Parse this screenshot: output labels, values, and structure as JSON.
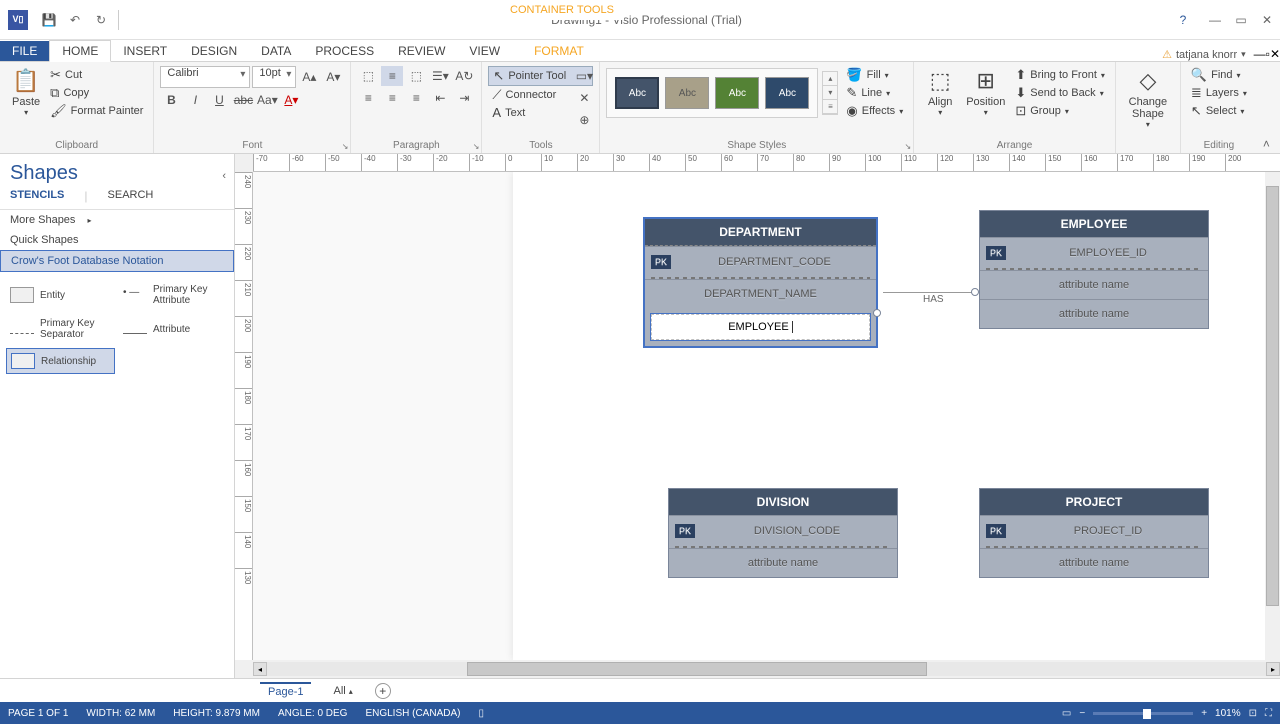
{
  "titlebar": {
    "visio_logo": "V▯",
    "title": "Drawing1 - Visio Professional (Trial)",
    "container_tools": "CONTAINER TOOLS"
  },
  "ribbon_tabs": {
    "file": "FILE",
    "home": "HOME",
    "insert": "INSERT",
    "design": "DESIGN",
    "data": "DATA",
    "process": "PROCESS",
    "review": "REVIEW",
    "view": "VIEW",
    "format": "FORMAT",
    "user": "tatjana knorr"
  },
  "ribbon": {
    "clipboard": {
      "paste": "Paste",
      "cut": "Cut",
      "copy": "Copy",
      "format_painter": "Format Painter",
      "label": "Clipboard"
    },
    "font": {
      "family": "Calibri",
      "size": "10pt",
      "label": "Font"
    },
    "paragraph": {
      "label": "Paragraph"
    },
    "tools": {
      "pointer": "Pointer Tool",
      "connector": "Connector",
      "text": "Text",
      "label": "Tools"
    },
    "shape_styles": {
      "abc": "Abc",
      "fill": "Fill",
      "line": "Line",
      "effects": "Effects",
      "label": "Shape Styles"
    },
    "arrange": {
      "align": "Align",
      "position": "Position",
      "bring_front": "Bring to Front",
      "send_back": "Send to Back",
      "group": "Group",
      "label": "Arrange"
    },
    "change_shape": "Change Shape",
    "editing": {
      "find": "Find",
      "layers": "Layers",
      "select": "Select",
      "label": "Editing"
    }
  },
  "shapes_panel": {
    "title": "Shapes",
    "tab_stencils": "STENCILS",
    "tab_search": "SEARCH",
    "more_shapes": "More Shapes",
    "quick_shapes": "Quick Shapes",
    "crows_foot": "Crow's Foot Database Notation",
    "entity": "Entity",
    "pk_attribute": "Primary Key Attribute",
    "pk_separator": "Primary Key Separator",
    "attribute": "Attribute",
    "relationship": "Relationship"
  },
  "canvas": {
    "ruler_h": [
      "-70",
      "-60",
      "-50",
      "-40",
      "-30",
      "-20",
      "-10",
      "0",
      "10",
      "20",
      "30",
      "40",
      "50",
      "60",
      "70",
      "80",
      "90",
      "100",
      "110",
      "120",
      "130",
      "140",
      "150",
      "160",
      "170",
      "180",
      "190",
      "200"
    ],
    "ruler_v": [
      "240",
      "230",
      "220",
      "210",
      "200",
      "190",
      "180",
      "170",
      "160",
      "150",
      "140",
      "130"
    ],
    "dept": {
      "title": "DEPARTMENT",
      "pk": "PK",
      "code": "DEPARTMENT_CODE",
      "name": "DEPARTMENT_NAME",
      "editing": "EMPLOYEE"
    },
    "emp": {
      "title": "EMPLOYEE",
      "pk": "PK",
      "id": "EMPLOYEE_ID",
      "a1": "attribute name",
      "a2": "attribute name"
    },
    "div": {
      "title": "DIVISION",
      "pk": "PK",
      "code": "DIVISION_CODE",
      "a1": "attribute name"
    },
    "proj": {
      "title": "PROJECT",
      "pk": "PK",
      "id": "PROJECT_ID",
      "a1": "attribute name"
    },
    "rel_has": "HAS"
  },
  "page_tabs": {
    "page1": "Page-1",
    "all": "All"
  },
  "statusbar": {
    "page": "PAGE 1 OF 1",
    "width": "WIDTH: 62 MM",
    "height": "HEIGHT: 9.879 MM",
    "angle": "ANGLE: 0 DEG",
    "lang": "ENGLISH (CANADA)",
    "zoom": "101%"
  }
}
